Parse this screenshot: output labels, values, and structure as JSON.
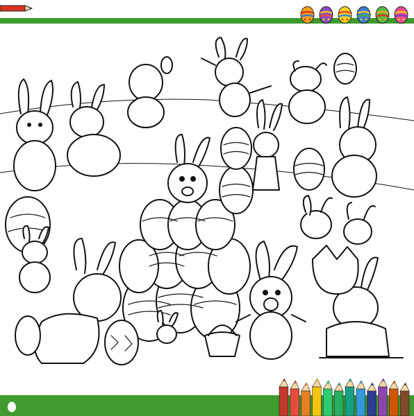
{
  "header": {
    "stripe_color": "#3f9b2e",
    "pencil_icon": "red-pencil-icon",
    "egg_icons": [
      {
        "name": "orange-egg-icon",
        "colors": [
          "#f4a21b",
          "#d9341f",
          "#3b7bd6"
        ]
      },
      {
        "name": "purple-egg-icon",
        "colors": [
          "#8b4cc7",
          "#f2c21c",
          "#e84c3d"
        ]
      },
      {
        "name": "yellow-egg-icon",
        "colors": [
          "#f4d21c",
          "#e8452f",
          "#3b8cd6"
        ]
      },
      {
        "name": "blue-egg-icon",
        "colors": [
          "#3b7bd6",
          "#f2c21c",
          "#4caf50"
        ]
      },
      {
        "name": "green-egg-icon",
        "colors": [
          "#58b947",
          "#f4a21b",
          "#d9341f"
        ]
      },
      {
        "name": "pink-egg-icon",
        "colors": [
          "#e84c93",
          "#f2c21c",
          "#7a3fb5"
        ]
      }
    ]
  },
  "scene": {
    "type": "coloring-page-line-art",
    "subject": "easter-bunnies-with-eggs"
  },
  "footer": {
    "stripe_color": "#3f9b2e",
    "egg_icon": "white-egg-icon",
    "pencil_colors": [
      "#c0392b",
      "#e74c3c",
      "#e67e22",
      "#f1c40f",
      "#2ecc71",
      "#27ae60",
      "#16a085",
      "#3498db",
      "#2c3e90",
      "#8e44ad",
      "#d35400",
      "#7f4b2a"
    ]
  }
}
